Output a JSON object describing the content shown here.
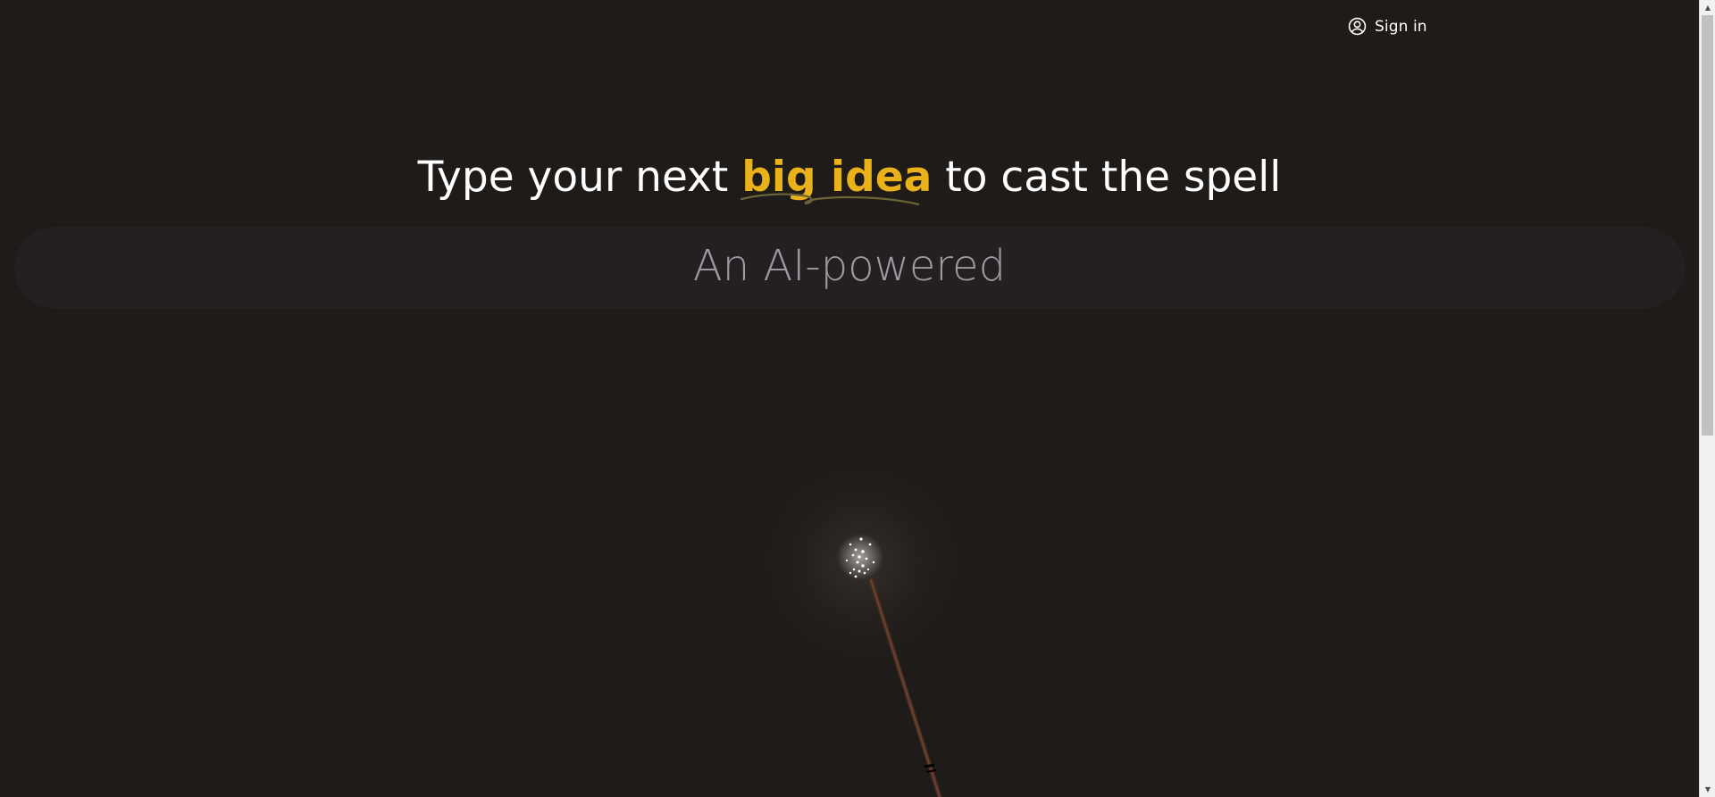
{
  "header": {
    "signin_label": "Sign in",
    "signin_icon": "user-circle-icon"
  },
  "hero": {
    "headline_before": "Type your next ",
    "headline_highlight": "big idea",
    "headline_after": " to cast the spell",
    "highlight_color": "#e9b11a"
  },
  "prompt": {
    "typed_text": "An AI-powered"
  },
  "colors": {
    "background": "#1f1b18",
    "bar": "#242022",
    "prompt_text": "#9b99a2"
  },
  "decor": {
    "wand_icon": "magic-wand-icon"
  }
}
